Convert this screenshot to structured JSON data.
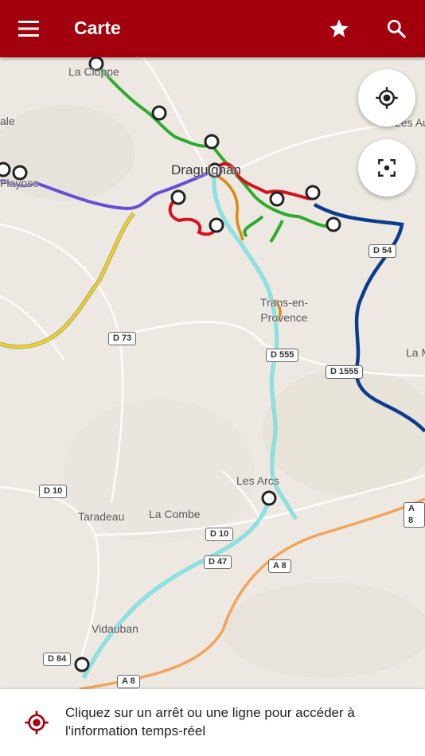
{
  "header": {
    "title": "Carte",
    "menu_icon": "menu-icon",
    "favorite_icon": "star-icon",
    "search_icon": "search-icon"
  },
  "map": {
    "place_labels": {
      "la_cluppe": "La Cluppe",
      "draguignan": "Draguignan",
      "trans": "Trans-en-Provence",
      "les_arcs": "Les Arcs",
      "taradeau": "Taradeau",
      "la_combe": "La Combe",
      "vidauban": "Vidauban",
      "la_motte": "La M",
      "le_muy_edge": "Les Au",
      "flayosc": "Flayosc",
      "ale": "ale"
    },
    "road_labels": {
      "d73": "D 73",
      "d555": "D 555",
      "d1555": "D 1555",
      "d54": "D 54",
      "d10a": "D 10",
      "d10b": "D 10",
      "d47": "D 47",
      "a8a": "A 8",
      "a8b": "A 8",
      "a8c": "A 8",
      "d84": "D 84"
    },
    "line_colors": {
      "green": "#2eab2e",
      "red": "#d8101c",
      "purple": "#6b4cd9",
      "yellow": "#f0d21e",
      "cyan": "#7eeaea",
      "navy": "#0c3c8e",
      "orange": "#d98b12",
      "motorway": "#f4a35a"
    }
  },
  "controls": {
    "locate_icon": "gps-locate-icon",
    "recenter_icon": "fit-screen-icon"
  },
  "footer": {
    "icon": "target-icon",
    "message": "Cliquez sur un arrêt ou une ligne pour accéder à l'information temps-réel"
  }
}
